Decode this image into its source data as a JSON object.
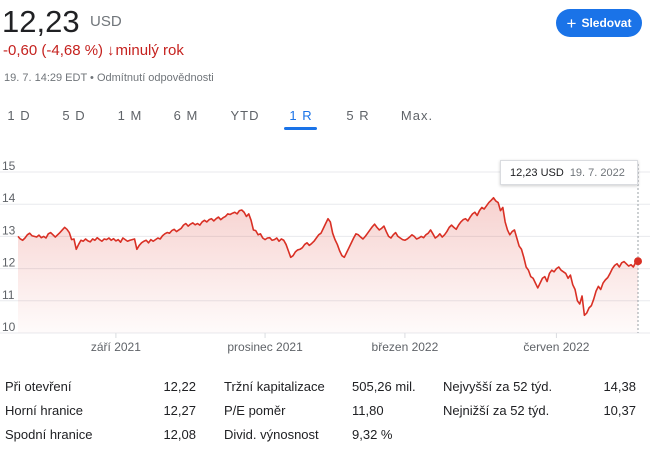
{
  "quote": {
    "price": "12,23",
    "currency": "USD",
    "change": "-0,60 (-4,68 %)",
    "change_arrow": "↓",
    "change_period": "minulý rok",
    "timestamp": "19. 7. 14:29 EDT",
    "separator": "•",
    "disclaimer": "Odmítnutí odpovědnosti"
  },
  "follow_button": {
    "icon": "plus-icon",
    "label": "Sledovat",
    "color": "#1a73e8"
  },
  "tabs": [
    {
      "label": "1 D",
      "active": false
    },
    {
      "label": "5 D",
      "active": false
    },
    {
      "label": "1 M",
      "active": false
    },
    {
      "label": "6 M",
      "active": false
    },
    {
      "label": "YTD",
      "active": false
    },
    {
      "label": "1 R",
      "active": true
    },
    {
      "label": "5 R",
      "active": false
    },
    {
      "label": "Max.",
      "active": false
    }
  ],
  "tooltip": {
    "price": "12,23 USD",
    "date": "19. 7. 2022"
  },
  "chart_data": {
    "type": "area",
    "line_color": "#d93025",
    "ylim": [
      10,
      15
    ],
    "yticks": [
      15,
      14,
      13,
      12,
      11,
      10
    ],
    "xticks": [
      {
        "label": "září 2021",
        "index": 42
      },
      {
        "label": "prosinec 2021",
        "index": 106
      },
      {
        "label": "březen 2022",
        "index": 166
      },
      {
        "label": "červen 2022",
        "index": 231
      }
    ],
    "grid": true,
    "last_point": {
      "date": "19. 7. 2022",
      "value": 12.23
    },
    "values": [
      13.0,
      12.92,
      12.88,
      12.95,
      13.05,
      13.1,
      13.02,
      13.0,
      12.98,
      13.04,
      12.96,
      13.0,
      12.95,
      13.08,
      13.12,
      13.05,
      12.98,
      13.05,
      13.12,
      13.2,
      13.28,
      13.22,
      13.12,
      12.9,
      12.92,
      12.6,
      12.75,
      12.88,
      12.85,
      12.92,
      12.86,
      12.83,
      12.92,
      12.88,
      12.96,
      12.9,
      12.85,
      12.92,
      12.9,
      12.95,
      12.88,
      12.93,
      12.86,
      12.9,
      12.82,
      12.95,
      12.9,
      12.85,
      12.88,
      12.9,
      12.92,
      12.6,
      12.72,
      12.8,
      12.85,
      12.88,
      12.8,
      12.9,
      12.85,
      12.9,
      12.95,
      12.92,
      13.02,
      13.08,
      13.12,
      13.1,
      13.18,
      13.22,
      13.15,
      13.2,
      13.25,
      13.35,
      13.4,
      13.32,
      13.38,
      13.42,
      13.36,
      13.4,
      13.35,
      13.45,
      13.5,
      13.45,
      13.52,
      13.55,
      13.48,
      13.55,
      13.6,
      13.52,
      13.58,
      13.62,
      13.7,
      13.68,
      13.72,
      13.75,
      13.7,
      13.8,
      13.82,
      13.75,
      13.62,
      13.7,
      13.5,
      13.2,
      13.18,
      13.05,
      13.08,
      12.95,
      12.9,
      12.95,
      12.96,
      12.88,
      12.9,
      12.95,
      12.85,
      12.92,
      12.88,
      12.75,
      12.55,
      12.35,
      12.4,
      12.52,
      12.58,
      12.6,
      12.65,
      12.75,
      12.8,
      12.72,
      12.78,
      12.85,
      12.95,
      13.05,
      13.1,
      13.25,
      13.4,
      13.55,
      13.45,
      13.1,
      12.9,
      12.75,
      12.55,
      12.4,
      12.35,
      12.5,
      12.65,
      12.8,
      12.95,
      13.08,
      13.05,
      12.98,
      12.92,
      13.0,
      13.1,
      13.2,
      13.3,
      13.38,
      13.28,
      13.2,
      13.25,
      13.32,
      13.15,
      13.0,
      12.95,
      13.05,
      13.12,
      13.0,
      12.95,
      12.9,
      12.88,
      12.92,
      12.98,
      13.05,
      13.0,
      12.92,
      12.95,
      13.0,
      12.96,
      13.05,
      13.1,
      13.2,
      13.08,
      12.95,
      13.0,
      13.08,
      12.98,
      13.05,
      13.15,
      13.28,
      13.35,
      13.28,
      13.22,
      13.35,
      13.45,
      13.52,
      13.55,
      13.48,
      13.6,
      13.7,
      13.75,
      13.65,
      13.8,
      13.9,
      13.85,
      13.95,
      14.05,
      14.12,
      14.2,
      14.1,
      14.05,
      13.8,
      13.9,
      13.45,
      13.2,
      13.05,
      13.15,
      13.2,
      12.95,
      12.7,
      12.6,
      12.35,
      12.05,
      11.95,
      11.75,
      11.7,
      11.55,
      11.4,
      11.55,
      11.7,
      11.75,
      11.6,
      11.85,
      11.95,
      11.9,
      12.0,
      12.05,
      11.95,
      11.9,
      11.85,
      11.7,
      11.8,
      11.5,
      11.35,
      11.0,
      10.9,
      11.15,
      10.55,
      10.62,
      10.78,
      10.85,
      11.05,
      11.3,
      11.45,
      11.35,
      11.55,
      11.65,
      11.72,
      11.85,
      12.0,
      12.1,
      12.15,
      12.05,
      12.18,
      12.22,
      12.15,
      12.08,
      12.12,
      12.05,
      12.2,
      12.23
    ]
  },
  "stats": {
    "col1": [
      {
        "label": "Při otevření",
        "value": "12,22"
      },
      {
        "label": "Horní hranice",
        "value": "12,27"
      },
      {
        "label": "Spodní hranice",
        "value": "12,08"
      }
    ],
    "col2": [
      {
        "label": "Tržní kapitalizace",
        "value": "505,26 mil."
      },
      {
        "label": "P/E poměr",
        "value": "11,80"
      },
      {
        "label": "Divid. výnosnost",
        "value": "9,32 %"
      }
    ],
    "col3": [
      {
        "label": "Nejvyšší za 52 týd.",
        "value": "14,38"
      },
      {
        "label": "Nejnižší za 52 týd.",
        "value": "10,37"
      }
    ]
  }
}
